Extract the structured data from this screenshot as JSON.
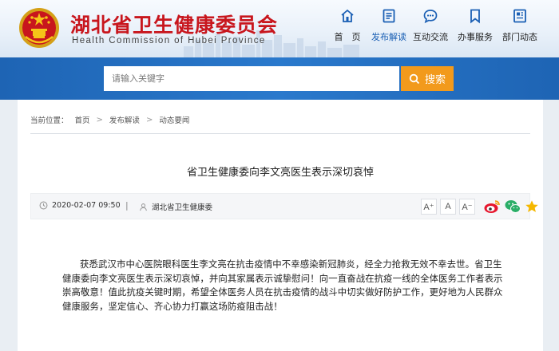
{
  "header": {
    "title": "湖北省卫生健康委员会",
    "subtitle": "Health Commission of Hubei Province",
    "nav": [
      {
        "label": "首　页",
        "icon": "home-icon"
      },
      {
        "label": "发布解读",
        "icon": "document-icon"
      },
      {
        "label": "互动交流",
        "icon": "chat-bubble-icon"
      },
      {
        "label": "办事服务",
        "icon": "bookmark-icon"
      },
      {
        "label": "部门动态",
        "icon": "news-icon"
      }
    ],
    "nav_active": "发布解读",
    "colors": {
      "title_red": "#c8161d",
      "nav_blue": "#1a5fb4"
    }
  },
  "search": {
    "placeholder": "请输入关键字",
    "button_label": "搜索",
    "colors": {
      "band": "#2a79cc",
      "button": "#f29a1c"
    }
  },
  "breadcrumb": {
    "prefix": "当前位置：",
    "items": [
      "首页",
      "发布解读",
      "动态要闻"
    ]
  },
  "article": {
    "title": "省卫生健康委向李文亮医生表示深切哀悼",
    "date": "2020-02-07 09:50",
    "divider": "|",
    "source": "湖北省卫生健康委",
    "font_sizes": [
      "A⁺",
      "A",
      "A⁻"
    ],
    "share": [
      "weibo-icon",
      "wechat-icon",
      "favorite-star-icon"
    ],
    "body": "获悉武汉市中心医院眼科医生李文亮在抗击疫情中不幸感染新冠肺炎，经全力抢救无效不幸去世。省卫生健康委向李文亮医生表示深切哀悼，并向其家属表示诚挚慰问！向一直奋战在抗疫一线的全体医务工作者表示崇高敬意！值此抗疫关键时期，希望全体医务人员在抗击疫情的战斗中切实做好防护工作，更好地为人民群众健康服务，坚定信心、齐心协力打赢这场防疫阻击战！"
  }
}
